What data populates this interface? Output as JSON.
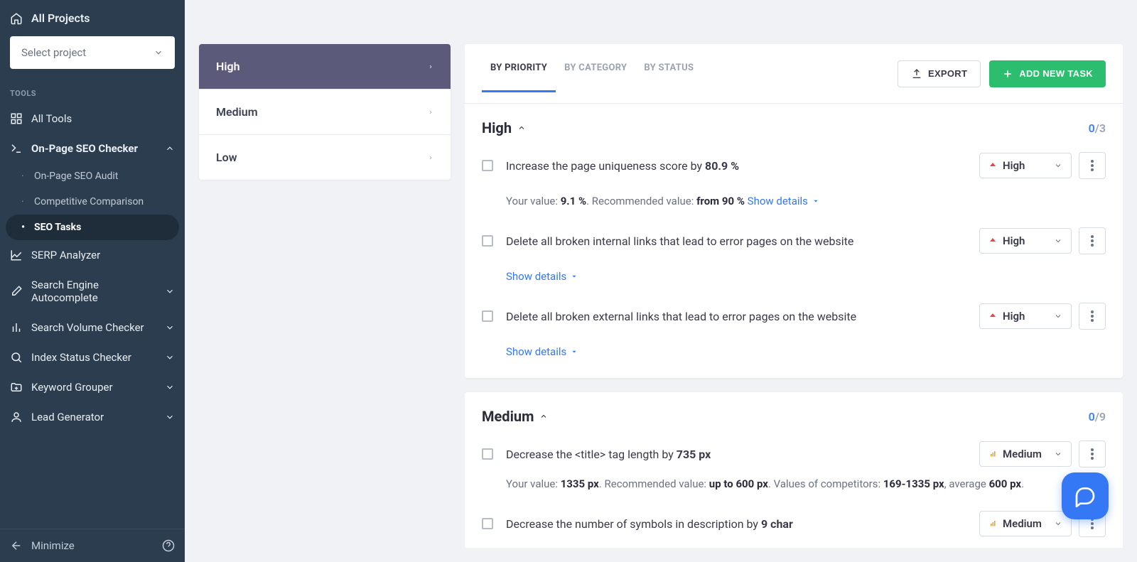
{
  "sidebar": {
    "all_projects": "All Projects",
    "select_project_placeholder": "Select project",
    "tools_label": "TOOLS",
    "items": [
      {
        "label": "All Tools",
        "icon": "grid"
      },
      {
        "label": "On-Page SEO Checker",
        "icon": "code",
        "expanded": true,
        "subitems": [
          {
            "label": "On-Page SEO Audit"
          },
          {
            "label": "Competitive Comparison"
          },
          {
            "label": "SEO Tasks",
            "active": true
          }
        ]
      },
      {
        "label": "SERP Analyzer",
        "icon": "chart"
      },
      {
        "label": "Search Engine Autocomplete",
        "icon": "pencil",
        "chevron": true
      },
      {
        "label": "Search Volume Checker",
        "icon": "bars",
        "chevron": true
      },
      {
        "label": "Index Status Checker",
        "icon": "search",
        "chevron": true
      },
      {
        "label": "Keyword Grouper",
        "icon": "folder",
        "chevron": true
      },
      {
        "label": "Lead Generator",
        "icon": "user",
        "chevron": true
      }
    ],
    "minimize": "Minimize"
  },
  "priority_nav": [
    {
      "label": "High",
      "active": true
    },
    {
      "label": "Medium"
    },
    {
      "label": "Low"
    }
  ],
  "tabs": [
    {
      "label": "BY PRIORITY",
      "active": true
    },
    {
      "label": "BY CATEGORY"
    },
    {
      "label": "BY STATUS"
    }
  ],
  "actions": {
    "export": "EXPORT",
    "add_task": "ADD NEW TASK"
  },
  "sections": {
    "high": {
      "title": "High",
      "done": "0",
      "total": "/3",
      "tasks": [
        {
          "label_pre": "Increase the page uniqueness score by ",
          "label_bold": "80.9 %",
          "sub_pre1": "Your value: ",
          "sub_bold1": "9.1 %",
          "sub_post1": ". Recommended value: ",
          "sub_bold2": "from 90 %",
          "show_details": "Show details",
          "priority": "High"
        },
        {
          "label_pre": "Delete all broken internal links that lead to error pages on the website",
          "show_details": "Show details",
          "priority": "High"
        },
        {
          "label_pre": "Delete all broken external links that lead to error pages on the website",
          "show_details": "Show details",
          "priority": "High"
        }
      ]
    },
    "medium": {
      "title": "Medium",
      "done": "0",
      "total": "/9",
      "tasks": [
        {
          "label_pre": "Decrease the <title> tag length by ",
          "label_bold": "735 px",
          "sub_pre1": "Your value: ",
          "sub_bold1": "1335 px",
          "sub_post1": ". Recommended value: ",
          "sub_bold2": "up to 600 px",
          "sub_post2": ". Values of competitors: ",
          "sub_bold3": "169-1335 px",
          "sub_post3": ", average ",
          "sub_bold4": "600 px",
          "sub_post4": ".",
          "priority": "Medium"
        },
        {
          "label_pre": "Decrease the number of symbols in description by ",
          "label_bold": "9 char",
          "priority": "Medium"
        }
      ]
    }
  }
}
